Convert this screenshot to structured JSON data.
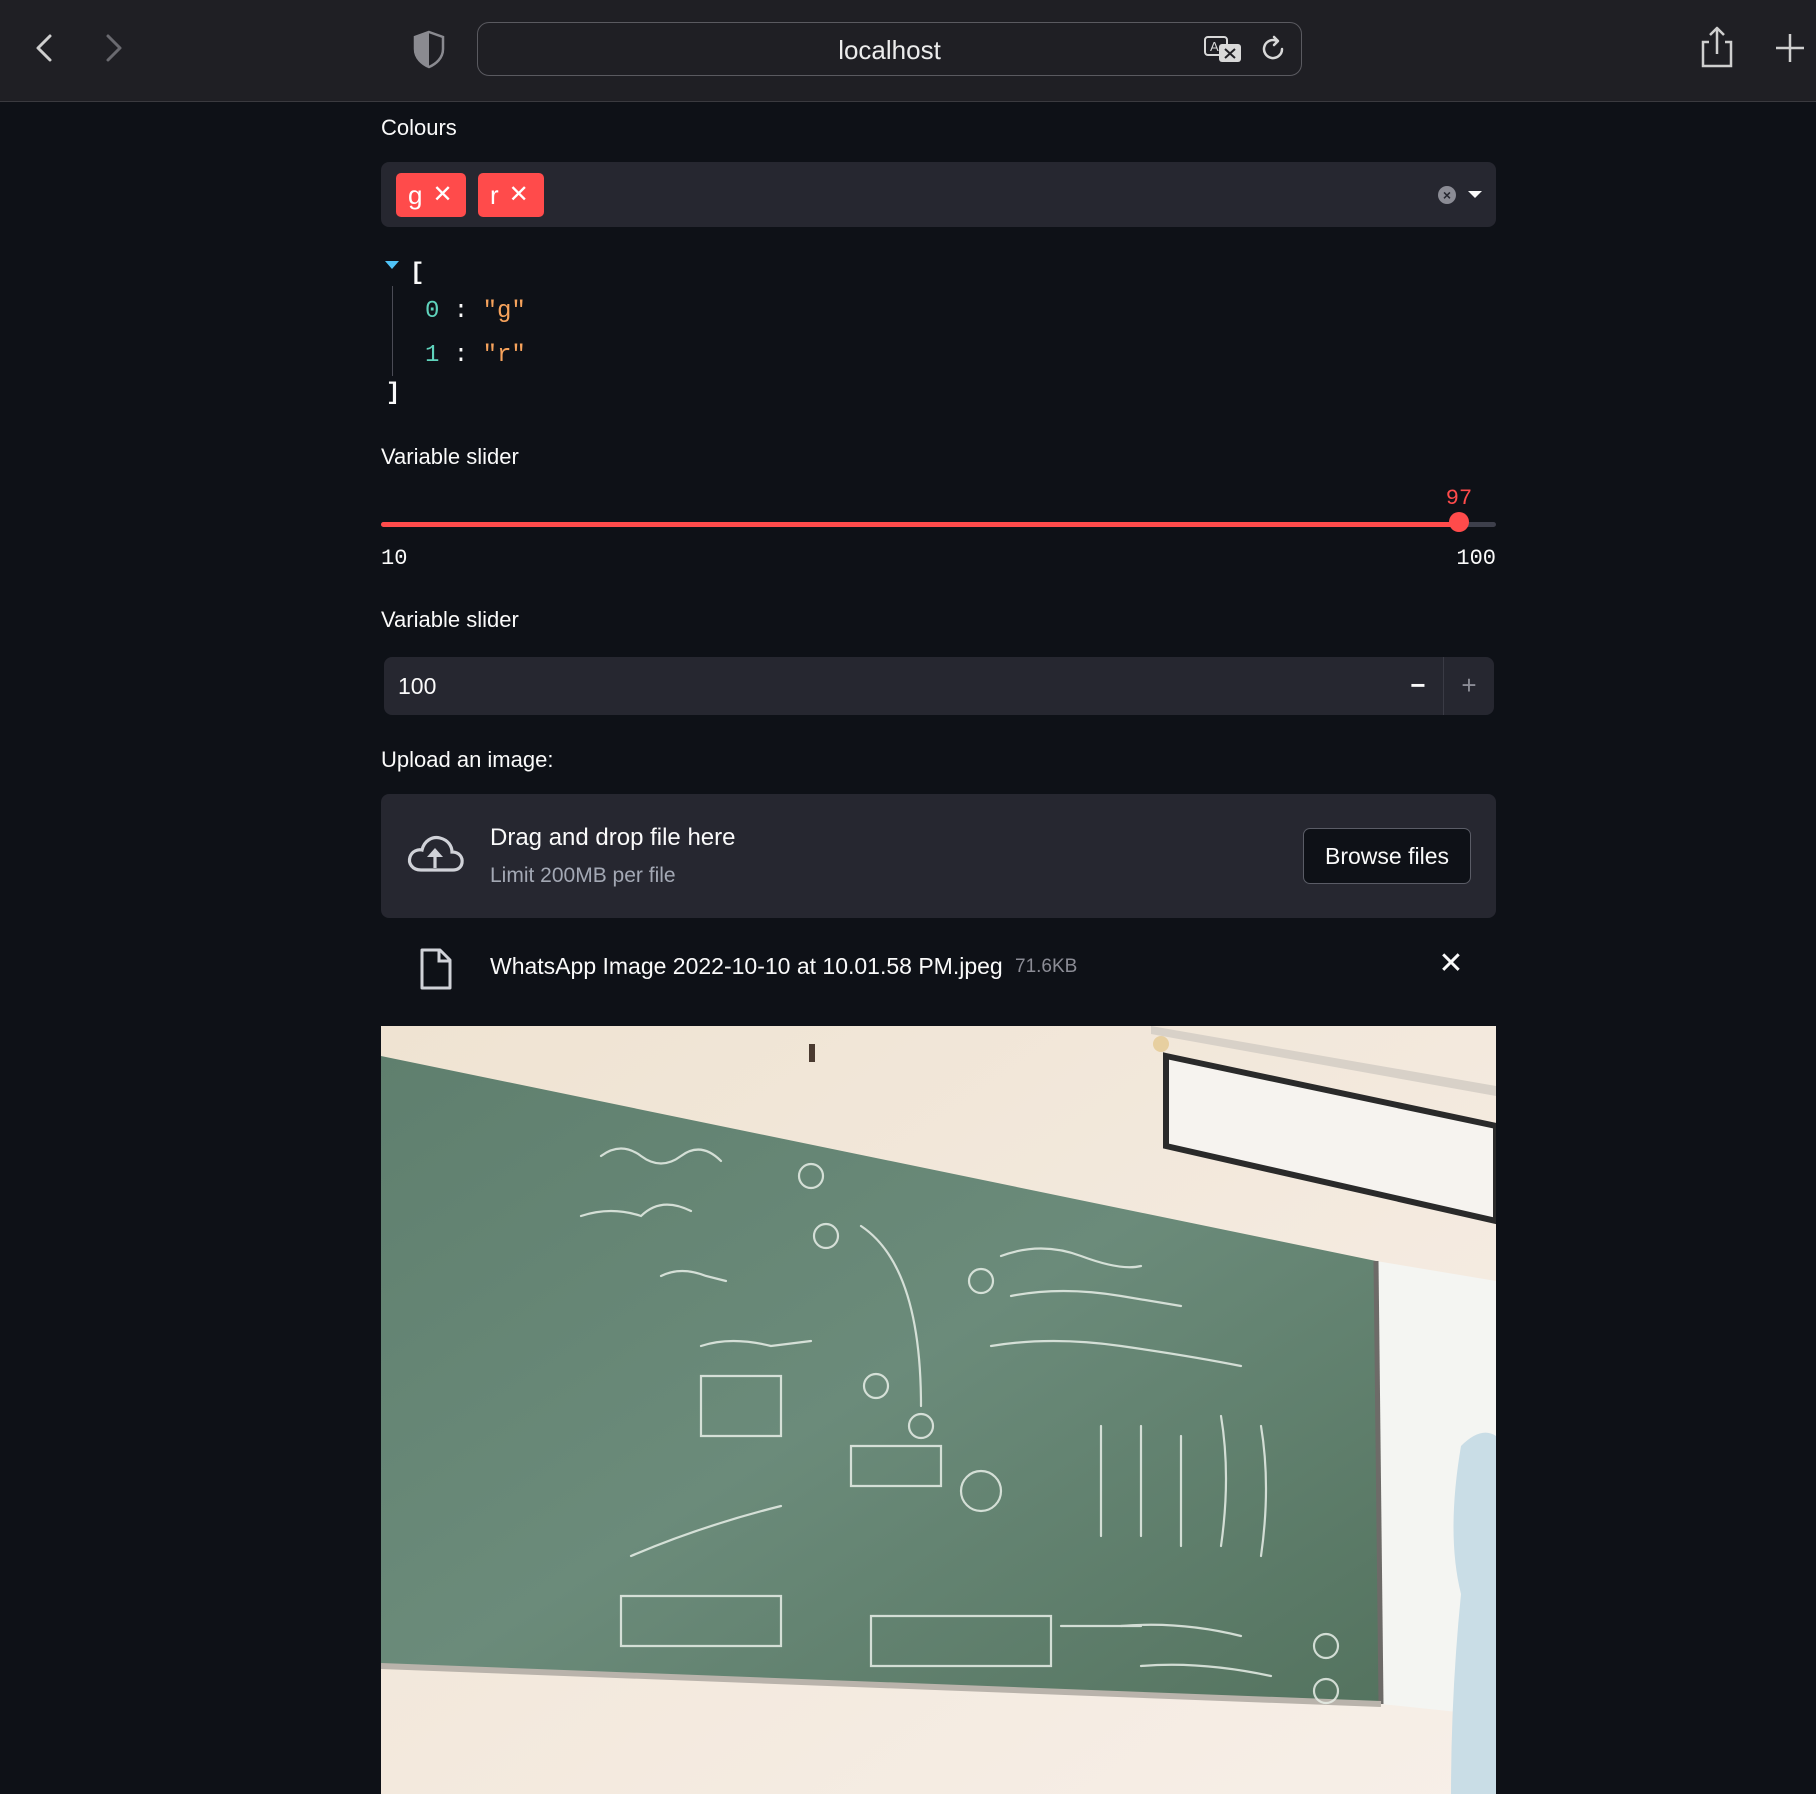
{
  "browser": {
    "url": "localhost",
    "icons": [
      "back-icon",
      "forward-icon",
      "shield-icon",
      "translate-icon",
      "reload-icon",
      "share-icon",
      "new-tab-icon"
    ]
  },
  "colours": {
    "label": "Colours",
    "tags": [
      {
        "text": "g",
        "remove": "✕"
      },
      {
        "text": "r",
        "remove": "✕"
      }
    ]
  },
  "json_view": {
    "open": "[",
    "close": "]",
    "items": [
      {
        "index": "0",
        "sep": " : ",
        "value": "\"g\""
      },
      {
        "index": "1",
        "sep": " : ",
        "value": "\"r\""
      }
    ]
  },
  "slider": {
    "label": "Variable slider",
    "value": "97",
    "min": "10",
    "max": "100",
    "fraction": 0.9667
  },
  "number_input": {
    "label": "Variable slider",
    "value": "100",
    "minus": "−",
    "plus": "+"
  },
  "uploader": {
    "label": "Upload an image:",
    "drag_text": "Drag and drop file here",
    "limit_text": "Limit 200MB per file",
    "browse_label": "Browse files",
    "file_name": "WhatsApp Image 2022-10-10 at 10.01.58 PM.jpeg",
    "file_size": "71.6KB",
    "remove": "✕"
  },
  "colors": {
    "accent": "#ff4b4b",
    "background": "#0e1117",
    "widget_bg": "#262730",
    "json_index": "#5fd3bc",
    "json_string": "#f7a35c"
  }
}
